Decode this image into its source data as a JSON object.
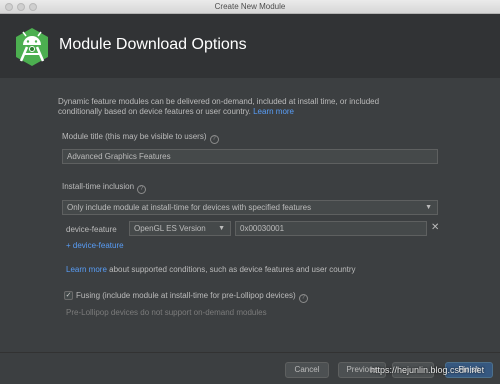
{
  "window": {
    "title": "Create New Module"
  },
  "header": {
    "title": "Module Download Options"
  },
  "description": {
    "line1": "Dynamic feature modules can be delivered on-demand, included at install time, or included",
    "line2": "conditionally based on device features or user country.",
    "learn_more": "Learn more"
  },
  "module_title": {
    "label": "Module title (this may be visible to users)",
    "value": "Advanced Graphics Features"
  },
  "install_time": {
    "label": "Install-time inclusion",
    "selected": "Only include module at install-time for devices with specified features"
  },
  "device_feature": {
    "label": "device-feature",
    "type_selected": "OpenGL ES Version",
    "value": "0x00030001",
    "add_label": "+ device-feature"
  },
  "supported_conditions": {
    "link": "Learn more",
    "text": "about supported conditions, such as device features and user country"
  },
  "fusing": {
    "checked": true,
    "label": "Fusing (include module at install-time for pre-Lollipop devices)",
    "note": "Pre-Lollipop devices do not support on-demand modules"
  },
  "buttons": {
    "cancel": "Cancel",
    "previous": "Previous",
    "finish": "Finish"
  },
  "watermark": "https://hejunlin.blog.csdn.net",
  "icons": {
    "help": "?",
    "close": "✕",
    "caret": "▼",
    "check": "✓"
  }
}
